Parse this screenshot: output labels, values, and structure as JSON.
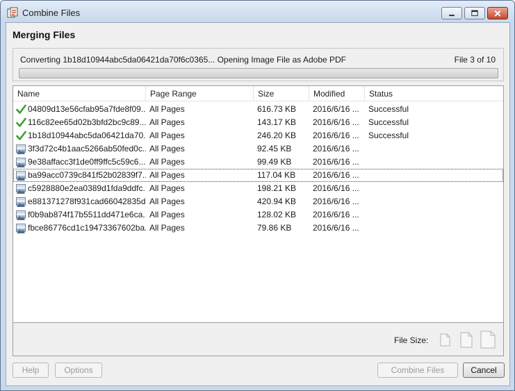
{
  "window": {
    "title": "Combine Files"
  },
  "heading": "Merging Files",
  "progress": {
    "text": "Converting 1b18d10944abc5da06421da70f6c0365... Opening Image File as Adobe PDF",
    "count": "File 3 of 10",
    "fraction": 0.0
  },
  "columns": {
    "name": "Name",
    "range": "Page Range",
    "size": "Size",
    "modified": "Modified",
    "status": "Status"
  },
  "rows": [
    {
      "icon": "check-icon",
      "name": "04809d13e56cfab95a7fde8f09...",
      "range": "All Pages",
      "size": "616.73 KB",
      "modified": "2016/6/16 ...",
      "status": "Successful"
    },
    {
      "icon": "check-icon",
      "name": "116c82ee65d02b3bfd2bc9c89...",
      "range": "All Pages",
      "size": "143.17 KB",
      "modified": "2016/6/16 ...",
      "status": "Successful"
    },
    {
      "icon": "check-icon",
      "name": "1b18d10944abc5da06421da70...",
      "range": "All Pages",
      "size": "246.20 KB",
      "modified": "2016/6/16 ...",
      "status": "Successful"
    },
    {
      "icon": "image-file-icon",
      "name": "3f3d72c4b1aac5266ab50fed0c...",
      "range": "All Pages",
      "size": "92.45 KB",
      "modified": "2016/6/16 ...",
      "status": ""
    },
    {
      "icon": "image-file-icon",
      "name": "9e38affacc3f1de0ff9ffc5c59c6...",
      "range": "All Pages",
      "size": "99.49 KB",
      "modified": "2016/6/16 ...",
      "status": ""
    },
    {
      "icon": "image-file-icon",
      "name": "ba99acc0739c841f52b02839f7...",
      "range": "All Pages",
      "size": "117.04 KB",
      "modified": "2016/6/16 ...",
      "status": ""
    },
    {
      "icon": "image-file-icon",
      "name": "c5928880e2ea0389d1fda9ddfc...",
      "range": "All Pages",
      "size": "198.21 KB",
      "modified": "2016/6/16 ...",
      "status": ""
    },
    {
      "icon": "image-file-icon",
      "name": "e881371278f931cad66042835d...",
      "range": "All Pages",
      "size": "420.94 KB",
      "modified": "2016/6/16 ...",
      "status": ""
    },
    {
      "icon": "image-file-icon",
      "name": "f0b9ab874f17b5511dd471e6ca...",
      "range": "All Pages",
      "size": "128.02 KB",
      "modified": "2016/6/16 ...",
      "status": ""
    },
    {
      "icon": "image-file-icon",
      "name": "fbce86776cd1c19473367602ba...",
      "range": "All Pages",
      "size": "79.86 KB",
      "modified": "2016/6/16 ...",
      "status": ""
    }
  ],
  "focused_row": 5,
  "file_size_label": "File Size:",
  "buttons": {
    "help": "Help",
    "options": "Options",
    "combine": "Combine Files",
    "cancel": "Cancel"
  },
  "colors": {
    "success_check": "#3aa02c",
    "close_button": "#c5492f"
  }
}
